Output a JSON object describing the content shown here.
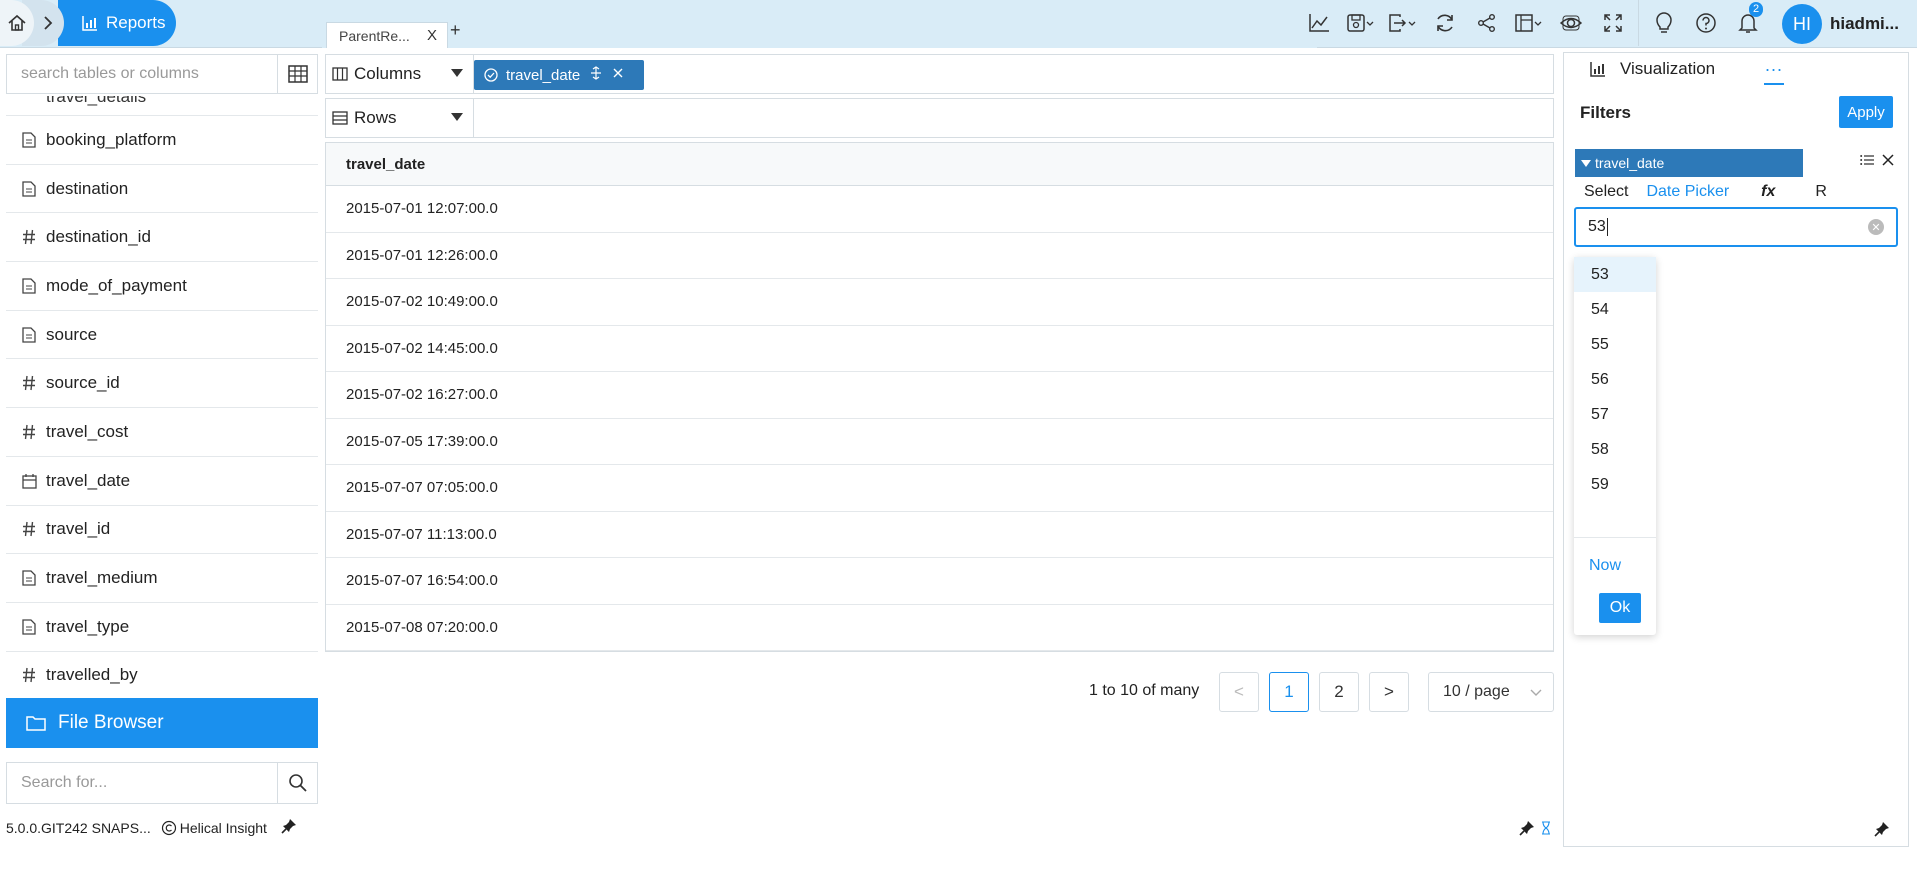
{
  "breadcrumb": {
    "current": "Reports"
  },
  "tabs": [
    {
      "label": "ParentRe...",
      "close": "X"
    }
  ],
  "tab_add": "+",
  "toolbar": {
    "icons": [
      "line-chart-icon",
      "save-icon",
      "export-icon",
      "refresh-icon",
      "share-icon",
      "layout-icon",
      "preview-icon",
      "fullscreen-icon",
      "lightbulb-icon",
      "help-icon",
      "bell-icon"
    ],
    "notification_count": "2"
  },
  "user": {
    "initials": "HI",
    "name": "hiadmi..."
  },
  "left_panel": {
    "search_placeholder": "search tables or columns",
    "cut_item": "travel_details",
    "fields": [
      {
        "label": "booking_platform",
        "icon": "text-icon"
      },
      {
        "label": "destination",
        "icon": "text-icon"
      },
      {
        "label": "destination_id",
        "icon": "hash-icon"
      },
      {
        "label": "mode_of_payment",
        "icon": "text-icon"
      },
      {
        "label": "source",
        "icon": "text-icon"
      },
      {
        "label": "source_id",
        "icon": "hash-icon"
      },
      {
        "label": "travel_cost",
        "icon": "hash-icon"
      },
      {
        "label": "travel_date",
        "icon": "calendar-icon"
      },
      {
        "label": "travel_id",
        "icon": "hash-icon"
      },
      {
        "label": "travel_medium",
        "icon": "text-icon"
      },
      {
        "label": "travel_type",
        "icon": "text-icon"
      },
      {
        "label": "travelled_by",
        "icon": "hash-icon"
      }
    ],
    "file_browser": "File Browser",
    "search_for_placeholder": "Search for...",
    "version": "5.0.0.GIT242 SNAPS...",
    "brand": "Helical Insight"
  },
  "shelves": {
    "columns_label": "Columns",
    "rows_label": "Rows",
    "column_pill": "travel_date"
  },
  "table": {
    "header": "travel_date",
    "rows": [
      "2015-07-01 12:07:00.0",
      "2015-07-01 12:26:00.0",
      "2015-07-02 10:49:00.0",
      "2015-07-02 14:45:00.0",
      "2015-07-02 16:27:00.0",
      "2015-07-05 17:39:00.0",
      "2015-07-07 07:05:00.0",
      "2015-07-07 11:13:00.0",
      "2015-07-07 16:54:00.0",
      "2015-07-08 07:20:00.0"
    ]
  },
  "pagination": {
    "range": "1 to 10 of many",
    "prev": "<",
    "pages": [
      "1",
      "2"
    ],
    "next": ">",
    "per_page": "10 / page"
  },
  "right_panel": {
    "tab": "Visualization",
    "more": "...",
    "filters_title": "Filters",
    "apply": "Apply",
    "filter_name": "travel_date",
    "filter_tabs": {
      "select": "Select",
      "date_picker": "Date Picker",
      "fx": "fx",
      "r": "R"
    },
    "input_value": "53",
    "options": [
      "53",
      "54",
      "55",
      "56",
      "57",
      "58",
      "59"
    ],
    "now": "Now",
    "ok": "Ok"
  },
  "colors": {
    "accent": "#1a90ee",
    "pill": "#2d79b8",
    "topbar": "#d9ecf7"
  }
}
